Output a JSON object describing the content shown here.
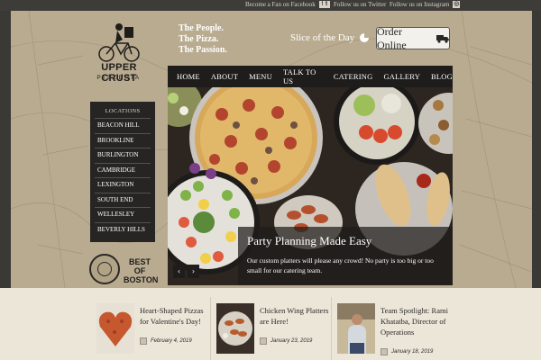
{
  "social": {
    "facebook": "Become a Fan on Facebook",
    "twitter": "Follow us on Twitter",
    "instagram": "Follow us on Instagram"
  },
  "brand": {
    "name": "UPPER CRUST",
    "sub": "PIZZERIA",
    "tagline": [
      "The People.",
      "The Pizza.",
      "The Passion."
    ]
  },
  "header": {
    "slice_of_day": "Slice of the Day",
    "order_online": "Order Online"
  },
  "nav": [
    "HOME",
    "ABOUT",
    "MENU",
    "TALK TO US",
    "CATERING",
    "GALLERY",
    "BLOG"
  ],
  "locations": {
    "heading": "LOCATIONS",
    "items": [
      "BEACON HILL",
      "BROOKLINE",
      "BURLINGTON",
      "CAMBRIDGE",
      "LEXINGTON",
      "SOUTH END",
      "WELLESLEY",
      "BEVERLY HILLS"
    ]
  },
  "badges": {
    "best_of_boston": [
      "BEST OF",
      "BOSTON"
    ]
  },
  "hero": {
    "title": "Party Planning Made Easy",
    "description": "Our custom platters will please any crowd! No party is too big or too small for our catering team.",
    "prev": "‹",
    "next": "›"
  },
  "news": [
    {
      "title": "Heart-Shaped Pizzas for Valentine's Day!",
      "date": "February 4, 2019"
    },
    {
      "title": "Chicken Wing Platters are Here!",
      "date": "January 23, 2019"
    },
    {
      "title": "Team Spotlight: Rami Khatatba, Director of Operations",
      "date": "January 18, 2019"
    }
  ],
  "colors": {
    "parchment": "#b9ab90",
    "nav": "#1e1d1b",
    "news_bg": "#ece6d9"
  }
}
